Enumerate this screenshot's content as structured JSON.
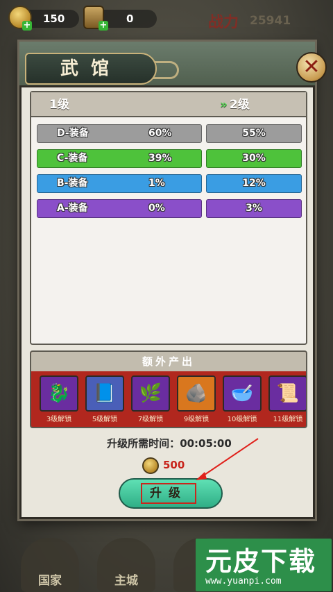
{
  "resources": {
    "coin": "150",
    "hourglass": "0",
    "power_label": "战力",
    "power_value": "25941"
  },
  "modal": {
    "title": "武馆",
    "close_glyph": "✕"
  },
  "levels": {
    "current": "1级",
    "next": "2级",
    "next_arrow": "»"
  },
  "equipment_rates": [
    {
      "name": "D-装备",
      "current": "60%",
      "next": "55%",
      "color": "#9c9c9c"
    },
    {
      "name": "C-装备",
      "current": "39%",
      "next": "30%",
      "color": "#4ec23b"
    },
    {
      "name": "B-装备",
      "current": "1%",
      "next": "12%",
      "color": "#3a9de3"
    },
    {
      "name": "A-装备",
      "current": "0%",
      "next": "3%",
      "color": "#8a4fc9"
    }
  ],
  "extra_output": {
    "title": "额外产出",
    "items": [
      {
        "icon": "jade-beast-icon",
        "glyph": "🐉",
        "label": "3级解锁",
        "bg": "#6a2da0"
      },
      {
        "icon": "book-icon",
        "glyph": "📘",
        "label": "5级解锁",
        "bg": "#4a5fb8"
      },
      {
        "icon": "herb-icon",
        "glyph": "🌿",
        "label": "7级解锁",
        "bg": "#6a2da0"
      },
      {
        "icon": "stone-tablet-icon",
        "glyph": "🪨",
        "label": "9级解锁",
        "bg": "#d9771e"
      },
      {
        "icon": "bowl-icon",
        "glyph": "🥣",
        "label": "10级解锁",
        "bg": "#6a2da0"
      },
      {
        "icon": "scroll-icon",
        "glyph": "📜",
        "label": "11级解锁",
        "bg": "#6a2da0"
      }
    ]
  },
  "upgrade": {
    "time_label": "升级所需时间：",
    "time_value": "00:05:00",
    "cost": "500",
    "button_label": "升级"
  },
  "bottom_nav": [
    {
      "label": "国家"
    },
    {
      "label": "主城"
    },
    {
      "label": ""
    }
  ],
  "watermark": {
    "title": "元皮下载",
    "url": "www.yuanpi.com"
  }
}
